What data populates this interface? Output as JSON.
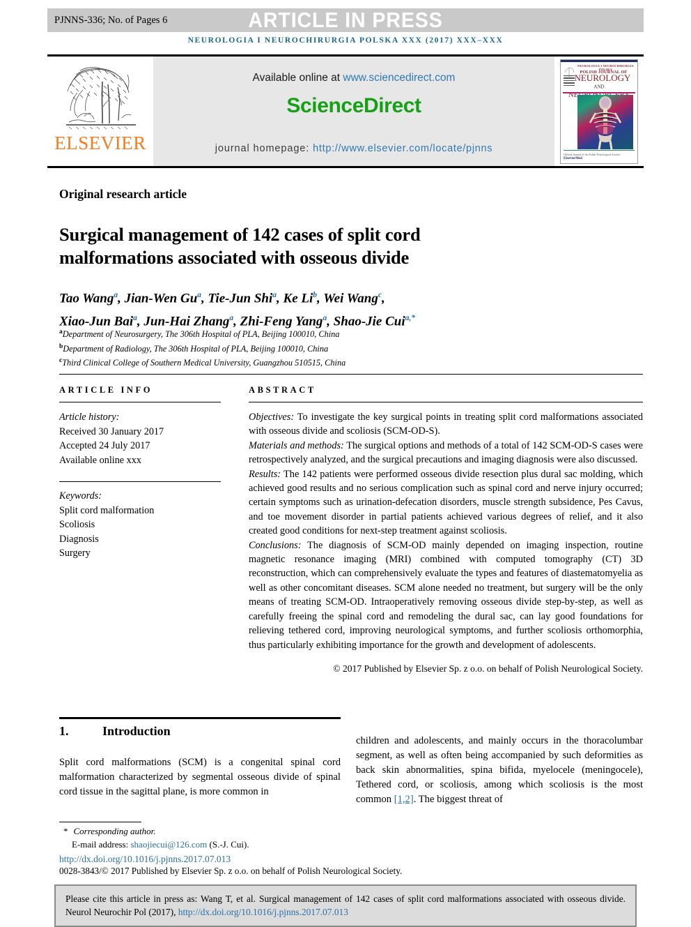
{
  "press_banner": {
    "article_id": "PJNNS-336; No. of Pages 6",
    "status": "ARTICLE IN PRESS"
  },
  "journal_ref": "NEUROLOGIA I NEUROCHIRURGIA POLSKA XXX (2017) XXX–XXX",
  "masthead": {
    "publisher": "ELSEVIER",
    "available_prefix": "Available online at ",
    "available_url": "www.sciencedirect.com",
    "sciencedirect_logo": "ScienceDirect",
    "homepage_prefix": "journal homepage: ",
    "homepage_url": "http://www.elsevier.com/locate/pjnns",
    "cover": {
      "top_line": "NEUROLOGIA I NEUROCHIRURGIA POLSKA",
      "polish": "POLISH JOURNAL OF",
      "neurology": "NEUROLOGY",
      "and": "AND",
      "neurosurgery": "NEUROSURGERY",
      "footer_small": "Official Journal of the Polish Neurological Society",
      "footer_brand": "ElsevierMed"
    }
  },
  "article_type": "Original research article",
  "title": "Surgical management of 142 cases of split cord malformations associated with osseous divide",
  "authors": [
    {
      "name": "Tao Wang",
      "sup": "a",
      "sep": ", "
    },
    {
      "name": "Jian-Wen Gu",
      "sup": "a",
      "sep": ", "
    },
    {
      "name": "Tie-Jun Shi",
      "sup": "a",
      "sep": ", "
    },
    {
      "name": "Ke Li",
      "sup": "b",
      "sep": ", "
    },
    {
      "name": "Wei Wang",
      "sup": "c",
      "sep": ","
    },
    {
      "name": "Xiao-Jun Bai",
      "sup": "a",
      "sep": ", "
    },
    {
      "name": "Jun-Hai Zhang",
      "sup": "a",
      "sep": ", "
    },
    {
      "name": "Zhi-Feng Yang",
      "sup": "a",
      "sep": ", "
    },
    {
      "name": "Shao-Jie Cui",
      "sup": "a,*",
      "sep": ""
    }
  ],
  "affiliations": [
    {
      "mark": "a",
      "text": "Department of Neurosurgery, The 306th Hospital of PLA, Beijing 100010, China"
    },
    {
      "mark": "b",
      "text": "Department of Radiology, The 306th Hospital of PLA, Beijing 100010, China"
    },
    {
      "mark": "c",
      "text": "Third Clinical College of Southern Medical University, Guangzhou 510515, China"
    }
  ],
  "article_info": {
    "heading": "ARTICLE INFO",
    "history_label": "Article history:",
    "received": "Received 30 January 2017",
    "accepted": "Accepted 24 July 2017",
    "available": "Available online xxx",
    "keywords_label": "Keywords:",
    "keywords": [
      "Split cord malformation",
      "Scoliosis",
      "Diagnosis",
      "Surgery"
    ]
  },
  "abstract": {
    "heading": "ABSTRACT",
    "objectives_label": "Objectives:",
    "objectives_text": " To investigate the key surgical points in treating split cord malformations associated with osseous divide and scoliosis (SCM-OD-S).",
    "materials_label": "Materials and methods:",
    "materials_text": " The surgical options and methods of a total of 142 SCM-OD-S cases were retrospectively analyzed, and the surgical precautions and imaging diagnosis were also discussed.",
    "results_label": "Results:",
    "results_text": " The 142 patients were performed osseous divide resection plus dural sac molding, which achieved good results and no serious complication such as spinal cord and nerve injury occurred; certain symptoms such as urination-defecation disorders, muscle strength subsidence, Pes Cavus, and toe movement disorder in partial patients achieved various degrees of relief, and it also created good conditions for next-step treatment against scoliosis.",
    "conclusions_label": "Conclusions:",
    "conclusions_text": " The diagnosis of SCM-OD mainly depended on imaging inspection, routine magnetic resonance imaging (MRI) combined with computed tomography (CT) 3D reconstruction, which can comprehensively evaluate the types and features of diastematomyelia as well as other concomitant diseases. SCM alone needed no treatment, but surgery will be the only means of treating SCM-OD. Intraoperatively removing osseous divide step-by-step, as well as carefully freeing the spinal cord and remodeling the dural sac, can lay good foundations for relieving tethered cord, improving neurological symptoms, and further scoliosis orthomorphia, thus particularly exhibiting importance for the growth and development of adolescents.",
    "copyright": "© 2017 Published by Elsevier Sp. z o.o. on behalf of Polish Neurological Society."
  },
  "section": {
    "number": "1.",
    "title": "Introduction",
    "left_text": "Split cord malformations (SCM) is a congenital spinal cord malformation characterized by segmental osseous divide of spinal cord tissue in the sagittal plane, is more common in",
    "right_text_before_ref": "children and adolescents, and mainly occurs in the thoracolumbar segment, as well as often being accompanied by such deformities as back skin abnormalities, spina bifida, myelocele (meningocele), Tethered cord, or scoliosis, among which scoliosis is the most common ",
    "right_ref": "[1,2]",
    "right_text_after_ref": ". The biggest threat of"
  },
  "footnote": {
    "corresponding": "Corresponding author.",
    "email_label": "E-mail address: ",
    "email": "shaojiecui@126.com",
    "email_suffix": " (S.-J. Cui).",
    "doi": "http://dx.doi.org/10.1016/j.pjnns.2017.07.013",
    "issn_line": "0028-3843/© 2017 Published by Elsevier Sp. z o.o. on behalf of Polish Neurological Society."
  },
  "cite_box": {
    "text_before_link": "Please cite this article in press as: Wang T, et al. Surgical management of 142 cases of split cord malformations associated with osseous divide. Neurol Neurochir Pol (2017), ",
    "link": "http://dx.doi.org/10.1016/j.pjnns.2017.07.013"
  },
  "colors": {
    "banner_gray": "#c9c9c9",
    "journal_blue": "#19688f",
    "link_blue": "#2b6fa8",
    "sciencedirect_green": "#16a016",
    "elsevier_orange": "#f47c20",
    "cover_maroon": "#8d1f2d",
    "cite_box_bg": "#dcdcdc"
  }
}
